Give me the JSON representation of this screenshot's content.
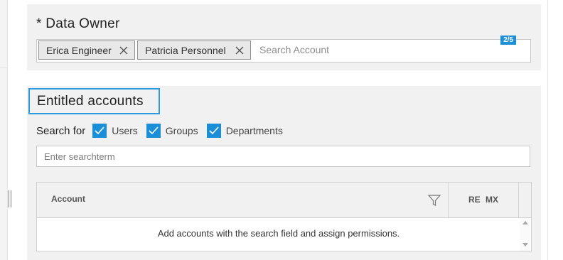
{
  "data_owner": {
    "title": "* Data Owner",
    "chips": [
      {
        "label": "Erica Engineer"
      },
      {
        "label": "Patricia Personnel"
      }
    ],
    "search_placeholder": "Search Account",
    "counter": "2/5"
  },
  "entitled": {
    "title": "Entitled accounts",
    "search_for_label": "Search for",
    "filters": [
      {
        "label": "Users",
        "checked": true
      },
      {
        "label": "Groups",
        "checked": true
      },
      {
        "label": "Departments",
        "checked": true
      }
    ],
    "term_placeholder": "Enter searchterm",
    "table": {
      "col_account": "Account",
      "col_re": "RE",
      "col_mx": "MX",
      "empty_message": "Add accounts with the search field and assign permissions."
    }
  },
  "icons": {
    "chip_remove": "close-icon",
    "checkbox": "checkmark-icon",
    "filter": "filter-funnel-icon"
  },
  "colors": {
    "accent": "#1a8fd8",
    "highlight_border": "#2d9be0",
    "panel_bg": "#f1f1f1"
  }
}
